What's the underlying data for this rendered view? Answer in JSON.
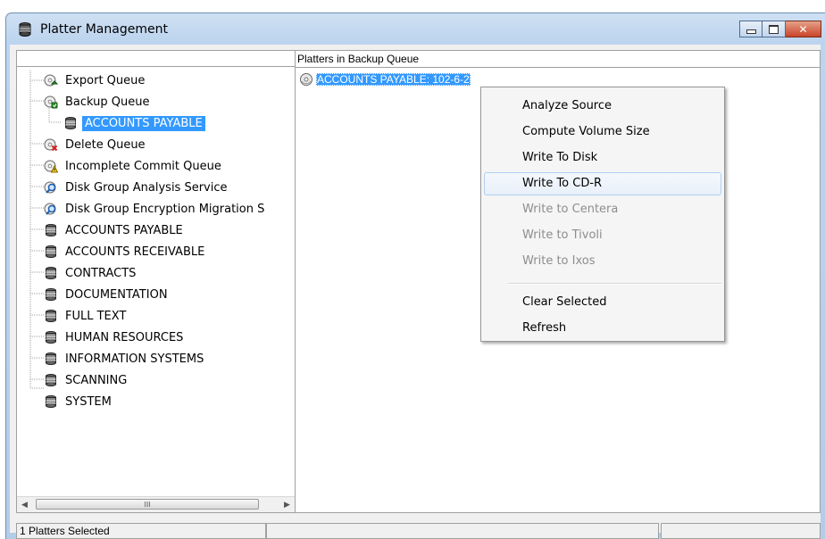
{
  "window": {
    "title": "Platter Management",
    "controls": {
      "minimize": "minimize-icon",
      "maximize": "maximize-icon",
      "close": "close-icon"
    }
  },
  "tree": {
    "items": [
      {
        "label": "Export Queue",
        "icon": "export-queue-icon",
        "level": 0
      },
      {
        "label": "Backup Queue",
        "icon": "backup-queue-icon",
        "level": 0
      },
      {
        "label": "ACCOUNTS PAYABLE",
        "icon": "database-icon",
        "level": 1,
        "selected": true
      },
      {
        "label": "Delete Queue",
        "icon": "delete-queue-icon",
        "level": 0
      },
      {
        "label": "Incomplete Commit Queue",
        "icon": "warning-queue-icon",
        "level": 0
      },
      {
        "label": "Disk Group Analysis Service",
        "icon": "analysis-service-icon",
        "level": 0
      },
      {
        "label": "Disk Group Encryption Migration S",
        "icon": "analysis-service-icon",
        "level": 0
      },
      {
        "label": "ACCOUNTS PAYABLE",
        "icon": "database-icon",
        "level": 0
      },
      {
        "label": "ACCOUNTS RECEIVABLE",
        "icon": "database-icon",
        "level": 0
      },
      {
        "label": "CONTRACTS",
        "icon": "database-icon",
        "level": 0
      },
      {
        "label": "DOCUMENTATION",
        "icon": "database-icon",
        "level": 0
      },
      {
        "label": "FULL TEXT",
        "icon": "database-icon",
        "level": 0
      },
      {
        "label": "HUMAN RESOURCES",
        "icon": "database-icon",
        "level": 0
      },
      {
        "label": "INFORMATION SYSTEMS",
        "icon": "database-icon",
        "level": 0
      },
      {
        "label": "SCANNING",
        "icon": "database-icon",
        "level": 0
      },
      {
        "label": "SYSTEM",
        "icon": "database-icon",
        "level": 0
      }
    ],
    "scroll_thumb_glyph": "III"
  },
  "right": {
    "header": "Platters in Backup Queue",
    "platter": {
      "label": "ACCOUNTS PAYABLE: 102-6-2",
      "icon": "platter-disc-icon"
    }
  },
  "context_menu": {
    "groups": [
      [
        {
          "label": "Analyze Source",
          "enabled": true
        },
        {
          "label": "Compute Volume Size",
          "enabled": true
        },
        {
          "label": "Write To Disk",
          "enabled": true
        },
        {
          "label": "Write To CD-R",
          "enabled": true,
          "hover": true
        },
        {
          "label": "Write to Centera",
          "enabled": false
        },
        {
          "label": "Write to Tivoli",
          "enabled": false
        },
        {
          "label": "Write to Ixos",
          "enabled": false
        }
      ],
      [
        {
          "label": "Clear Selected",
          "enabled": true
        },
        {
          "label": "Refresh",
          "enabled": true
        }
      ]
    ]
  },
  "statusbar": {
    "message": "1 Platters Selected",
    "panel2": "",
    "panel3": ""
  },
  "colors": {
    "selection": "#3399ff",
    "title_gradient_top": "#cfe0f3",
    "close_button": "#c8442a",
    "disabled_text": "#8d8d8d"
  }
}
